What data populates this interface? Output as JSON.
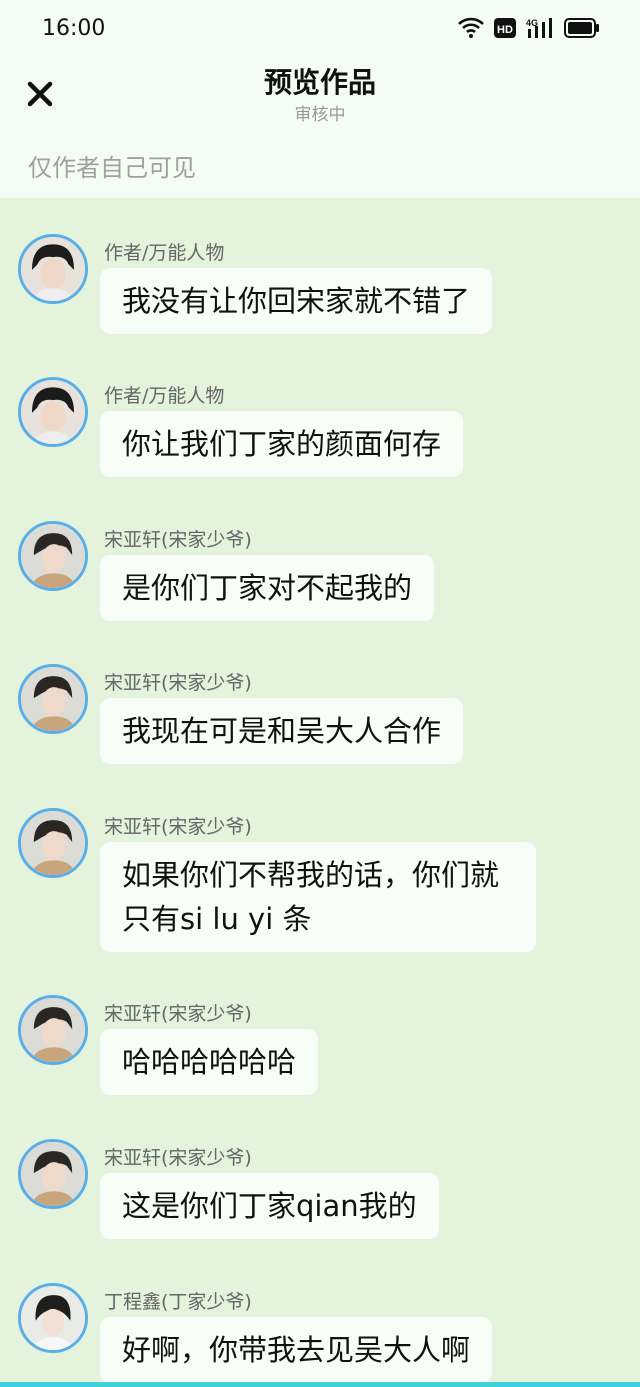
{
  "status_bar": {
    "time": "16:00",
    "icons": [
      "wifi-icon",
      "hd-icon",
      "4g-signal-icon",
      "battery-icon"
    ],
    "hd_label": "HD",
    "network_label": "4G"
  },
  "header": {
    "title": "预览作品",
    "subtitle": "审核中",
    "close_icon": "close-icon",
    "visibility_note": "仅作者自己可见"
  },
  "colors": {
    "chat_background": "#e3f3dc",
    "header_background": "#f5fcf5",
    "bubble": "#f8fdf7",
    "avatar_ring": "#5aaee8",
    "bottom_bar": "#3fd0d8"
  },
  "messages": [
    {
      "sender": "作者/万能人物",
      "text": "我没有让你回宋家就不错了"
    },
    {
      "sender": "作者/万能人物",
      "text": "你让我们丁家的颜面何存"
    },
    {
      "sender": "宋亚轩(宋家少爷)",
      "text": "是你们丁家对不起我的"
    },
    {
      "sender": "宋亚轩(宋家少爷)",
      "text": "我现在可是和吴大人合作"
    },
    {
      "sender": "宋亚轩(宋家少爷)",
      "text_line1": "如果你们不帮我的话，你们就",
      "text_line2": "只有si lu yi 条"
    },
    {
      "sender": "宋亚轩(宋家少爷)",
      "text": "哈哈哈哈哈哈"
    },
    {
      "sender": "宋亚轩(宋家少爷)",
      "text": "这是你们丁家qian我的"
    },
    {
      "sender": "丁程鑫(丁家少爷)",
      "text": "好啊，你带我去见吴大人啊"
    }
  ]
}
